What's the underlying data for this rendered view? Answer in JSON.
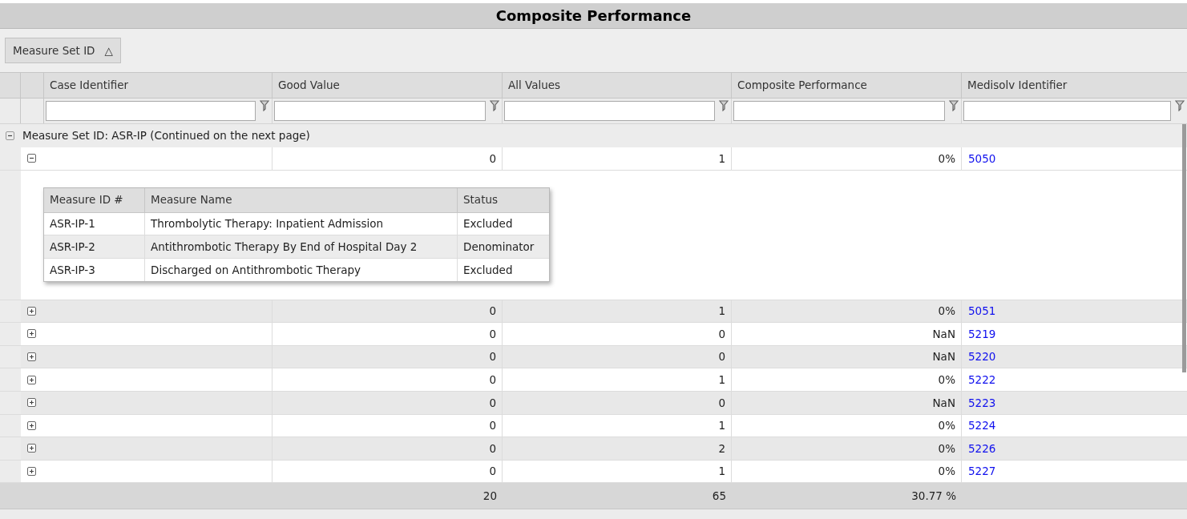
{
  "title": "Composite Performance",
  "group_button": {
    "label": "Measure Set ID",
    "sort_icon": "△"
  },
  "columns": [
    "Case Identifier",
    "Good Value",
    "All Values",
    "Composite Performance",
    "Medisolv Identifier"
  ],
  "group": {
    "label": "Measure Set ID: ASR-IP (Continued on the next page)",
    "expanded": true
  },
  "rows": [
    {
      "good_value": "0",
      "all_values": "1",
      "composite": "0%",
      "medisolv_id": "5050",
      "expanded": true,
      "detail": {
        "columns": [
          "Measure ID #",
          "Measure Name",
          "Status"
        ],
        "rows": [
          [
            "ASR-IP-1",
            "Thrombolytic Therapy: Inpatient Admission",
            "Excluded"
          ],
          [
            "ASR-IP-2",
            "Antithrombotic Therapy By End of Hospital Day 2",
            "Denominator"
          ],
          [
            "ASR-IP-3",
            "Discharged on Antithrombotic Therapy",
            "Excluded"
          ]
        ]
      }
    },
    {
      "good_value": "0",
      "all_values": "1",
      "composite": "0%",
      "medisolv_id": "5051",
      "expanded": false
    },
    {
      "good_value": "0",
      "all_values": "0",
      "composite": "NaN",
      "medisolv_id": "5219",
      "expanded": false
    },
    {
      "good_value": "0",
      "all_values": "0",
      "composite": "NaN",
      "medisolv_id": "5220",
      "expanded": false
    },
    {
      "good_value": "0",
      "all_values": "1",
      "composite": "0%",
      "medisolv_id": "5222",
      "expanded": false
    },
    {
      "good_value": "0",
      "all_values": "0",
      "composite": "NaN",
      "medisolv_id": "5223",
      "expanded": false
    },
    {
      "good_value": "0",
      "all_values": "1",
      "composite": "0%",
      "medisolv_id": "5224",
      "expanded": false
    },
    {
      "good_value": "0",
      "all_values": "2",
      "composite": "0%",
      "medisolv_id": "5226",
      "expanded": false
    },
    {
      "good_value": "0",
      "all_values": "1",
      "composite": "0%",
      "medisolv_id": "5227",
      "expanded": false
    }
  ],
  "totals": {
    "good_value": "20",
    "all_values": "65",
    "composite": "30.77 %"
  }
}
